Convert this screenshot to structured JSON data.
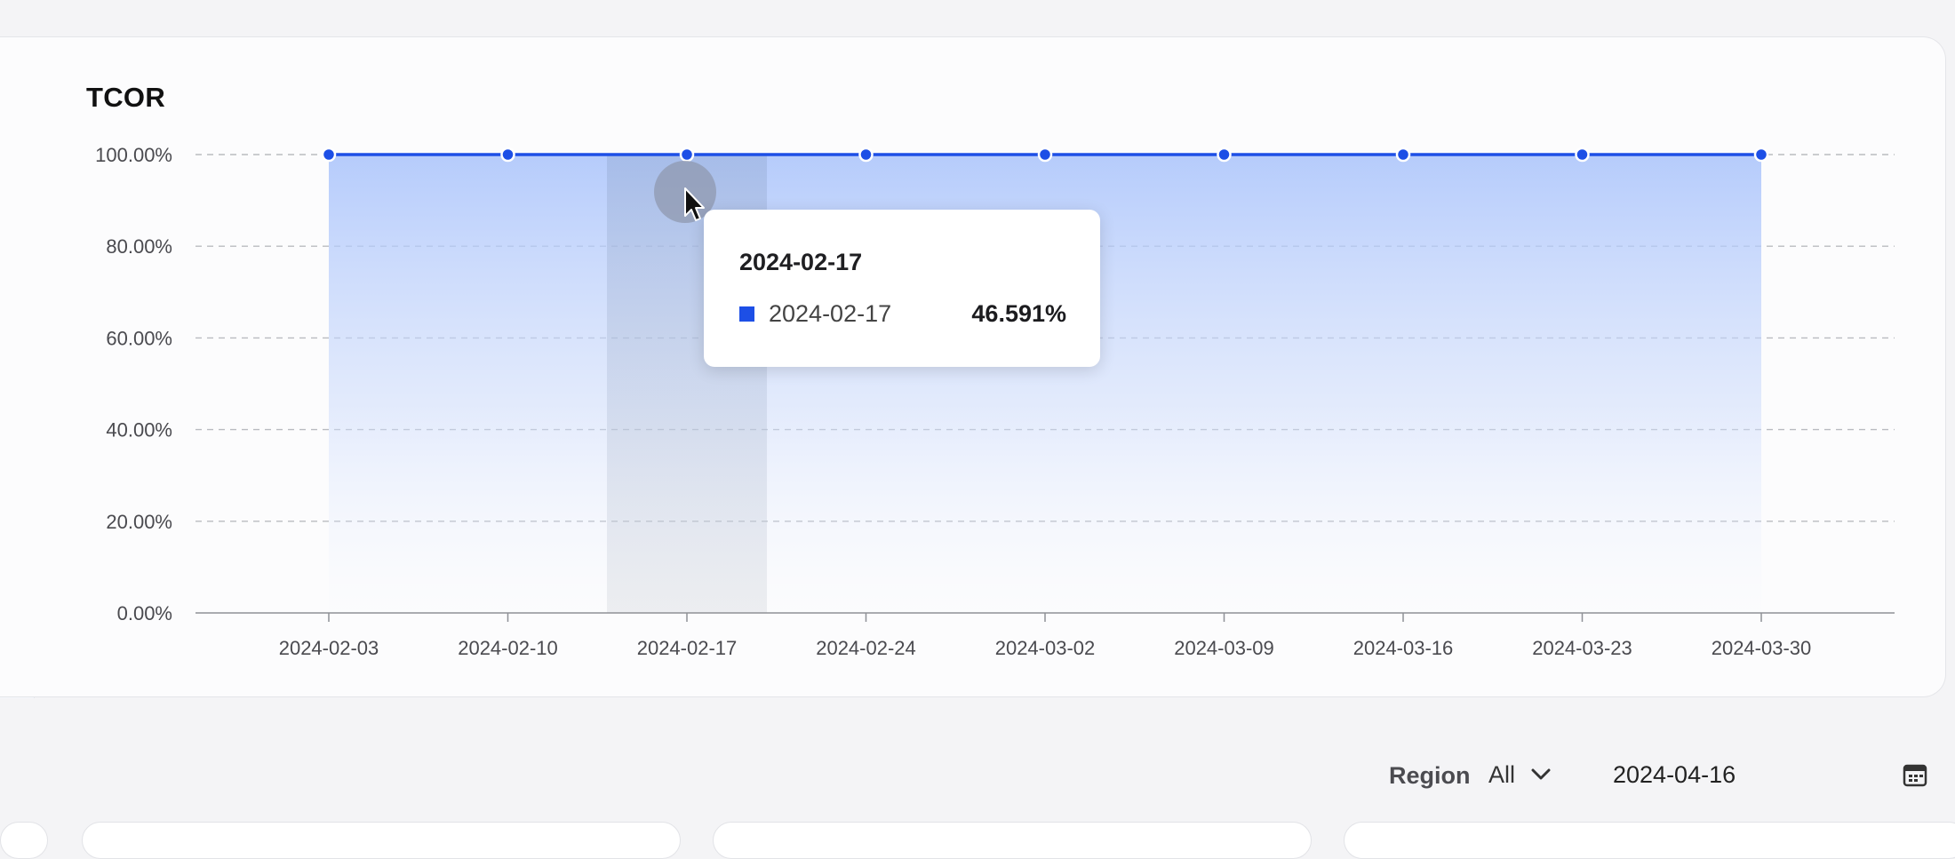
{
  "chart_card": {
    "title": "TCOR"
  },
  "chart_data": {
    "type": "area",
    "title": "TCOR",
    "x": [
      "2024-02-03",
      "2024-02-10",
      "2024-02-17",
      "2024-02-24",
      "2024-03-02",
      "2024-03-09",
      "2024-03-16",
      "2024-03-23",
      "2024-03-30"
    ],
    "series": [
      {
        "values": [
          100,
          100,
          100,
          100,
          100,
          100,
          100,
          100,
          100
        ]
      }
    ],
    "y_ticks": [
      "0.00%",
      "20.00%",
      "40.00%",
      "60.00%",
      "80.00%",
      "100.00%"
    ],
    "ylim": [
      0,
      100
    ],
    "y_format": "percent",
    "grid": "horizontal-dashed",
    "line_color": "#1d4fe6",
    "fill_color": "#a9c3fb",
    "highlighted_x": "2024-02-17"
  },
  "tooltip": {
    "title": "2024-02-17",
    "series_label": "2024-02-17",
    "value": "46.591%",
    "swatch_color": "#1d4fe6"
  },
  "filters": {
    "region_label": "Region",
    "region_value": "All",
    "date_value": "2024-04-16"
  },
  "icons": {
    "cursor": "cursor-arrow-icon",
    "chevron": "chevron-down-icon",
    "calendar": "calendar-icon"
  }
}
